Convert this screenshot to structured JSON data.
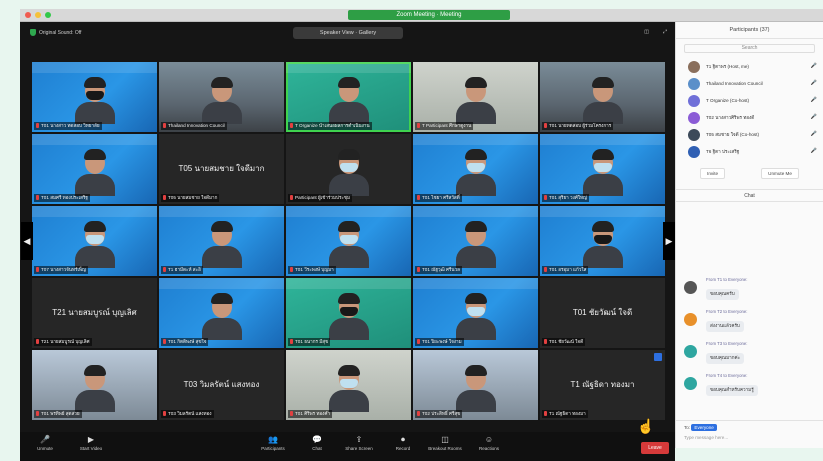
{
  "window": {
    "title": "Zoom Meeting  ·  Meeting"
  },
  "topbar": {
    "left_label": "Original Sound: Off",
    "view_label": "Speaker View · Gallery",
    "right_items": [
      "◫",
      "⤢"
    ]
  },
  "tiles": [
    {
      "style": "blue",
      "name": "T01 นางสาว ทดสอบ วิทยาลัย",
      "mask": "black"
    },
    {
      "style": "room",
      "name": "Thailand Innovation Council"
    },
    {
      "style": "green",
      "name": "T Organize นำเสนอผลการดำเนินงาน",
      "active": true
    },
    {
      "style": "photo",
      "name": "T Participant ศึกษาดูงาน"
    },
    {
      "style": "room",
      "name": "T01 นายทดสอบ ผู้ร่วมโครงการ"
    },
    {
      "style": "blue",
      "name": "T01 สมศรี ทองประเสริฐ"
    },
    {
      "style": "dark",
      "center": "T05 นายสมชาย ใจดีมาก",
      "name": "T05 นายสมชาย ใจดีมาก"
    },
    {
      "style": "dark",
      "name": "Participant ผู้เข้าร่วมประชุม",
      "mask": "light"
    },
    {
      "style": "blue",
      "name": "T01 ไชยา ศรีสวัสดิ์",
      "mask": "light"
    },
    {
      "style": "blue",
      "name": "T01 สุริยา วงศ์ใหญ่",
      "mask": "light"
    },
    {
      "style": "blue",
      "name": "T07 นางสาวจันทร์เพ็ญ",
      "mask": "light"
    },
    {
      "style": "blue",
      "name": "T1 ฮามีดะห์ สะอิ"
    },
    {
      "style": "blue",
      "name": "T01 วีระพงษ์ บุญมา",
      "mask": "light"
    },
    {
      "style": "blue",
      "name": "T01 ณัฐวุฒิ ศรีนวล"
    },
    {
      "style": "blue",
      "name": "T01 อรอุมา แก้วใส",
      "mask": "black"
    },
    {
      "style": "dark",
      "center": "T21 นายสมบูรณ์ บุญเลิศ",
      "name": "T21 นายสมบูรณ์ บุญเลิศ"
    },
    {
      "style": "blue",
      "name": "T01 กิตติพงษ์ สุขใจ"
    },
    {
      "style": "green",
      "name": "T01 ธนากร มีสุข",
      "mask": "black"
    },
    {
      "style": "blue",
      "name": "T01 ปิยะพงษ์ ใจงาม",
      "mask": "light"
    },
    {
      "style": "dark",
      "center": "T01 ชัยวัฒน์ ใจดี",
      "name": "T01 ชัยวัฒน์ ใจดี"
    },
    {
      "style": "window",
      "name": "T01 พรทิพย์ สุดสวย"
    },
    {
      "style": "dark",
      "center": "T03 วิมลรัตน์ แสงทอง",
      "name": "T03 วิมลรัตน์ แสงทอง"
    },
    {
      "style": "photo",
      "name": "T01 ศิริพร ทองคำ",
      "mask": "light"
    },
    {
      "style": "window",
      "name": "T02 ประสิทธิ์ ศรีสุข"
    },
    {
      "style": "dark",
      "center": "T1 ณัฐธิดา ทองมา",
      "name": "T1 ณัฐธิดา ทองมา",
      "fullscreen": true
    }
  ],
  "pager": {
    "left": "◀",
    "right": "▶"
  },
  "controls": {
    "items": [
      {
        "icon": "🎤",
        "label": "Unmute"
      },
      {
        "icon": "▶",
        "label": "Start Video"
      },
      {
        "icon": "👥",
        "label": "Participants"
      },
      {
        "icon": "💬",
        "label": "Chat"
      },
      {
        "icon": "⇪",
        "label": "Share Screen"
      },
      {
        "icon": "⏺",
        "label": "Record"
      },
      {
        "icon": "◫",
        "label": "Breakout Rooms"
      },
      {
        "icon": "☺",
        "label": "Reactions"
      }
    ],
    "end_label": "Leave"
  },
  "sidebar": {
    "participants_title": "Participants (37)",
    "search_placeholder": "Search",
    "participants": [
      {
        "name": "T1 ฐิตาพร (Host, me)",
        "status": "🎤",
        "color": "#8a6f5c"
      },
      {
        "name": "Thailand Innovation Council",
        "status": "🎤",
        "color": "#5b8fc9"
      },
      {
        "name": "T Organize (Co-host)",
        "status": "🎤",
        "color": "#6f6fd8"
      },
      {
        "name": "T02 นางสาวศิริพร ทองดี",
        "status": "🎤",
        "color": "#8b5cd6"
      },
      {
        "name": "T05 สมชาย ใจดี (Co-host)",
        "status": "🎤",
        "color": "#3d4a5a"
      },
      {
        "name": "T6 ฐิตา ประเสริฐ",
        "status": "🎤",
        "color": "#2f5fb3"
      }
    ],
    "actions": [
      "Invite",
      "Unmute Me"
    ],
    "chat_title": "Chat",
    "messages": [
      {
        "meta": "From T1 to Everyone:",
        "text": "ขอบคุณครับ",
        "color": "#555"
      },
      {
        "meta": "From T2 to Everyone:",
        "text": "ส่งงานแล้วครับ",
        "color": "#e8902a"
      },
      {
        "meta": "From T3 to Everyone:",
        "text": "ขอบคุณมากค่ะ",
        "color": "#2ea6a0"
      },
      {
        "meta": "From T4 to Everyone:",
        "text": "ขอบคุณสำหรับความรู้",
        "color": "#2ea6a0"
      }
    ],
    "chat_to_label": "To:",
    "chat_to_value": "Everyone",
    "chat_placeholder": "Type message here..."
  }
}
